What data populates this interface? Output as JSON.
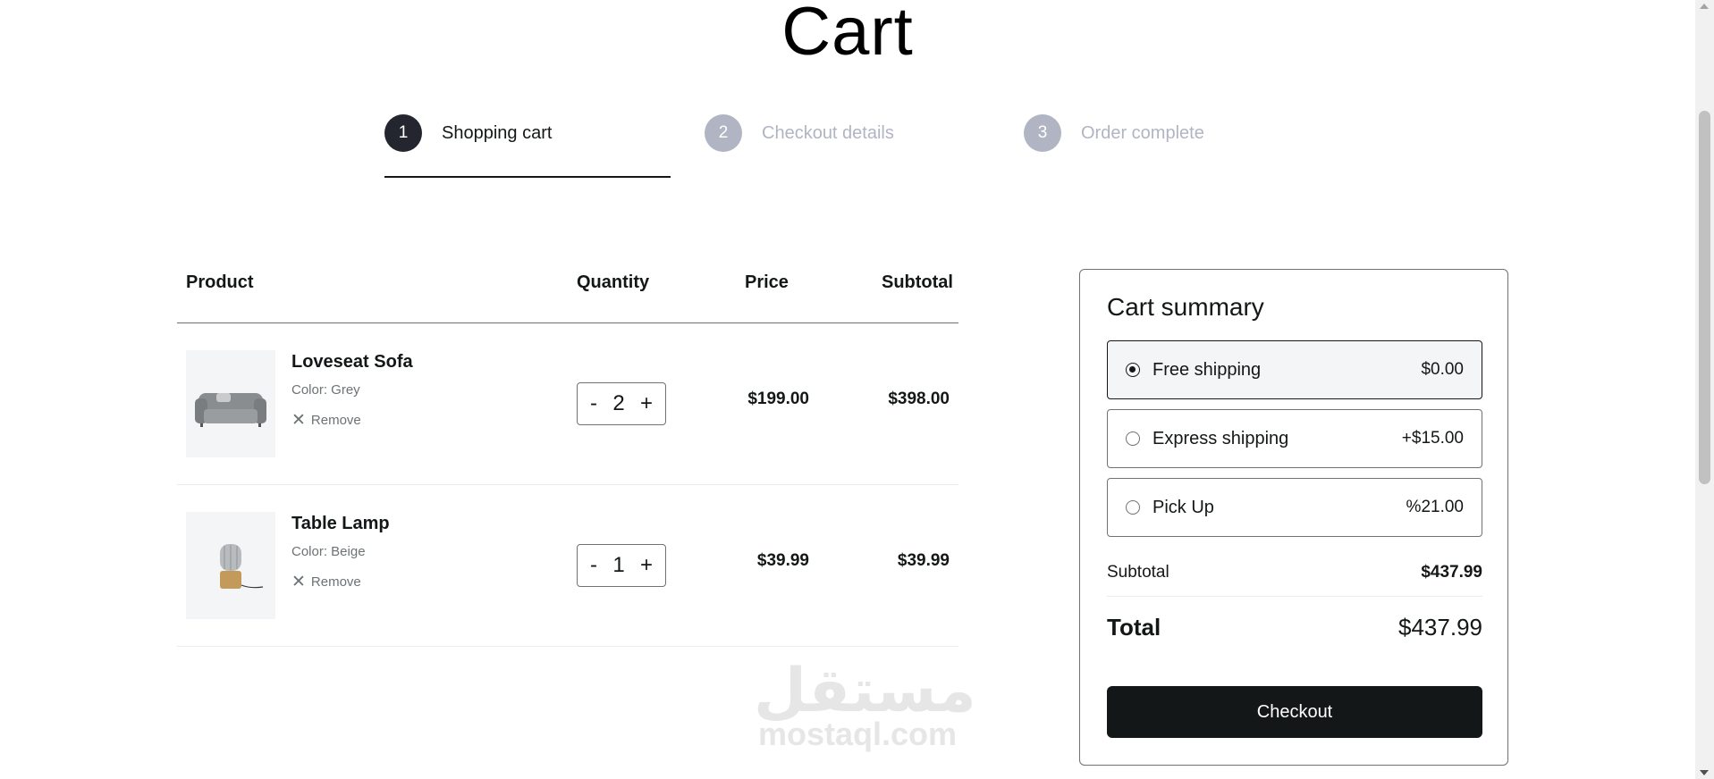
{
  "page": {
    "title": "Cart"
  },
  "steps": [
    {
      "num": "1",
      "label": "Shopping cart",
      "state": "active"
    },
    {
      "num": "2",
      "label": "Checkout details",
      "state": "inactive"
    },
    {
      "num": "3",
      "label": "Order complete",
      "state": "inactive"
    }
  ],
  "table": {
    "headers": {
      "product": "Product",
      "quantity": "Quantity",
      "price": "Price",
      "subtotal": "Subtotal"
    },
    "rows": [
      {
        "name": "Loveseat Sofa",
        "color": "Color: Grey",
        "remove": "Remove",
        "qty": "2",
        "minus": "-",
        "plus": "+",
        "price": "$199.00",
        "subtotal": "$398.00"
      },
      {
        "name": "Table Lamp",
        "color": "Color: Beige",
        "remove": "Remove",
        "qty": "1",
        "minus": "-",
        "plus": "+",
        "price": "$39.99",
        "subtotal": "$39.99"
      }
    ]
  },
  "summary": {
    "title": "Cart summary",
    "options": [
      {
        "label": "Free shipping",
        "price": "$0.00",
        "selected": true
      },
      {
        "label": "Express shipping",
        "price": "+$15.00",
        "selected": false
      },
      {
        "label": "Pick Up",
        "price": "%21.00",
        "selected": false
      }
    ],
    "subtotal_label": "Subtotal",
    "subtotal_value": "$437.99",
    "total_label": "Total",
    "total_value": "$437.99",
    "checkout_label": "Checkout"
  },
  "watermark": {
    "arabic": "مستقل",
    "latin": "mostaql.com"
  },
  "icons": {
    "remove": "close-icon",
    "radio": "radio-icon"
  },
  "colors": {
    "primary": "#141718",
    "muted": "#b1b5c3",
    "panel": "#f3f5f7"
  }
}
